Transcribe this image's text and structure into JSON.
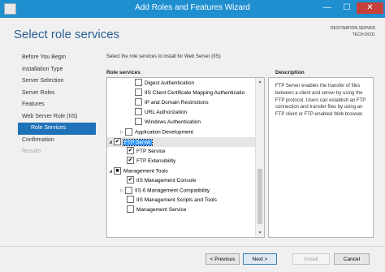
{
  "window": {
    "title": "Add Roles and Features Wizard",
    "minimize_glyph": "—",
    "maximize_glyph": "☐",
    "close_glyph": "✕"
  },
  "page": {
    "title": "Select role services"
  },
  "destination": {
    "label": "DESTINATION SERVER",
    "server": "TECH-DC01"
  },
  "nav": {
    "items": [
      {
        "label": "Before You Begin"
      },
      {
        "label": "Installation Type"
      },
      {
        "label": "Server Selection"
      },
      {
        "label": "Server Roles"
      },
      {
        "label": "Features"
      },
      {
        "label": "Web Server Role (IIS)"
      },
      {
        "label": "Role Services"
      },
      {
        "label": "Confirmation"
      },
      {
        "label": "Results"
      }
    ]
  },
  "main": {
    "instruction": "Select the role services to install for Web Server (IIS)",
    "role_services_header": "Role services",
    "description_header": "Description"
  },
  "tree": {
    "items": [
      {
        "label": "Digest Authentication",
        "check": ""
      },
      {
        "label": "IIS Client Certificate Mapping Authenticatio",
        "check": ""
      },
      {
        "label": "IP and Domain Restrictions",
        "check": ""
      },
      {
        "label": "URL Authorization",
        "check": ""
      },
      {
        "label": "Windows Authentication",
        "check": ""
      },
      {
        "label": "Application Development",
        "check": "",
        "arrow": "▷"
      },
      {
        "label": "FTP Server",
        "check": "✔",
        "arrow": "◢"
      },
      {
        "label": "FTP Service",
        "check": "✔"
      },
      {
        "label": "FTP Extensibility",
        "check": "✔"
      },
      {
        "label": "Management Tools",
        "check": "■",
        "arrow": "◢"
      },
      {
        "label": "IIS Management Console",
        "check": "✔"
      },
      {
        "label": "IIS 6 Management Compatibility",
        "check": "",
        "arrow": "▷"
      },
      {
        "label": "IIS Management Scripts and Tools",
        "check": ""
      },
      {
        "label": "Management Service",
        "check": ""
      }
    ],
    "scroll_up_glyph": "▲",
    "scroll_down_glyph": "▼"
  },
  "description": {
    "text": "FTP Server enables the transfer of files between a client and server by using the FTP protocol. Users can establish an FTP connection and transfer files by using an FTP client or FTP-enabled Web browser."
  },
  "buttons": {
    "previous": "< Previous",
    "next": "Next >",
    "install": "Install",
    "cancel": "Cancel"
  },
  "colors": {
    "titlebar": "#1f8fd0",
    "accent": "#1f71b8",
    "selection": "#3399ff",
    "close": "#c7413a"
  }
}
